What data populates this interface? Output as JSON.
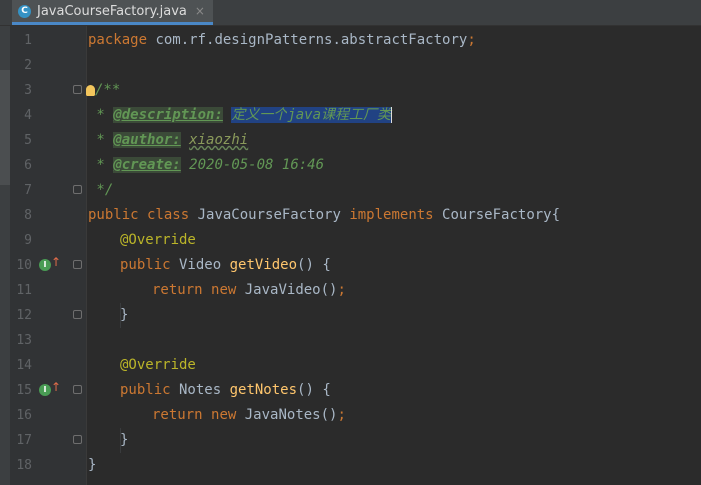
{
  "tab": {
    "icon_letter": "C",
    "filename": "JavaCourseFactory.java",
    "close": "×"
  },
  "line_numbers": [
    "1",
    "2",
    "3",
    "4",
    "5",
    "6",
    "7",
    "8",
    "9",
    "10",
    "11",
    "12",
    "13",
    "14",
    "15",
    "16",
    "17",
    "18"
  ],
  "code": {
    "l1_kw": "package",
    "l1_rest": " com.rf.designPatterns.abstractFactory",
    "l1_semi": ";",
    "l3_open": "/**",
    "l4_star": " * ",
    "l4_tag": "@description:",
    "l4_sp": " ",
    "l4_sel_a": "定义一个",
    "l4_sel_b": "java",
    "l4_sel_c": "课程工厂类",
    "l5_star": " * ",
    "l5_tag": "@author:",
    "l5_sp": " ",
    "l5_val": "xiaozhi",
    "l6_star": " * ",
    "l6_tag": "@create:",
    "l6_sp": " ",
    "l6_val": "2020-05-08 16:46",
    "l7_close": " */",
    "l8_kw1": "public class",
    "l8_name": " JavaCourseFactory ",
    "l8_kw2": "implements",
    "l8_rest": " CourseFactory{",
    "l9_ann": "@Override",
    "l10_kw": "public",
    "l10_type": " Video ",
    "l10_fn": "getVideo",
    "l10_rest": "() {",
    "l11_kw1": "return",
    "l11_kw2": "new",
    "l11_rest": " JavaVideo()",
    "l11_semi": ";",
    "l12": "}",
    "l14_ann": "@Override",
    "l15_kw": "public",
    "l15_type": " Notes ",
    "l15_fn": "getNotes",
    "l15_rest": "() {",
    "l16_kw1": "return",
    "l16_kw2": "new",
    "l16_rest": " JavaNotes()",
    "l16_semi": ";",
    "l17": "}",
    "l18": "}"
  },
  "gutter_icons": {
    "implements_letter": "I",
    "arrow": "↑"
  },
  "colors": {
    "background": "#2b2b2b",
    "keyword": "#cc7832",
    "method": "#ffc66d",
    "annotation": "#bbb529",
    "doc_comment": "#629755",
    "selection": "#214283"
  }
}
